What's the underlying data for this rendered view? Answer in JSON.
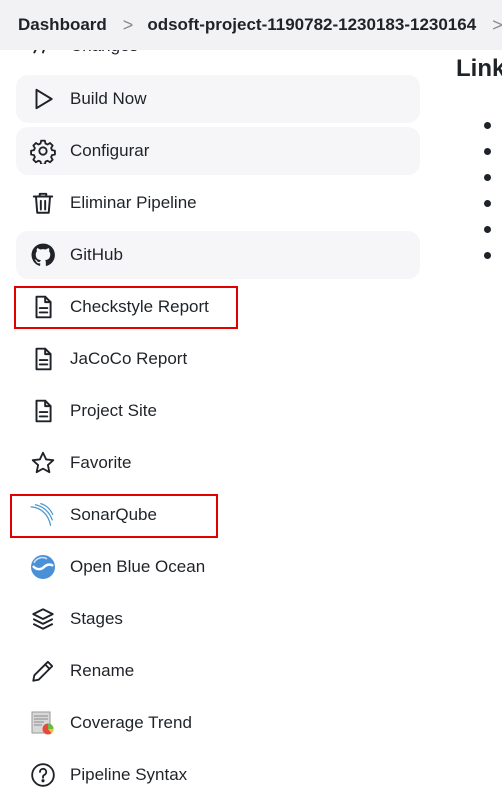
{
  "breadcrumb": {
    "items": [
      "Dashboard",
      "odsoft-project-1190782-1230183-1230164"
    ],
    "separator": ">"
  },
  "sidebar": {
    "partial_item": "Changes",
    "items": [
      {
        "label": "Build Now",
        "icon": "play-icon"
      },
      {
        "label": "Configurar",
        "icon": "gear-icon"
      },
      {
        "label": "Eliminar Pipeline",
        "icon": "trash-icon"
      },
      {
        "label": "GitHub",
        "icon": "github-icon"
      },
      {
        "label": "Checkstyle Report",
        "icon": "document-icon"
      },
      {
        "label": "JaCoCo Report",
        "icon": "document-icon"
      },
      {
        "label": "Project Site",
        "icon": "document-icon"
      },
      {
        "label": "Favorite",
        "icon": "star-icon"
      },
      {
        "label": "SonarQube",
        "icon": "sonarqube-icon"
      },
      {
        "label": "Open Blue Ocean",
        "icon": "blue-ocean-icon"
      },
      {
        "label": "Stages",
        "icon": "layers-icon"
      },
      {
        "label": "Rename",
        "icon": "pencil-icon"
      },
      {
        "label": "Coverage Trend",
        "icon": "coverage-chart-icon"
      },
      {
        "label": "Pipeline Syntax",
        "icon": "help-circle-icon"
      }
    ]
  },
  "main": {
    "heading": "Link"
  },
  "colors": {
    "highlight_outline": "#e00000",
    "hover_bg": "#f6f6f8",
    "breadcrumb_bg": "#f2f2f4"
  }
}
